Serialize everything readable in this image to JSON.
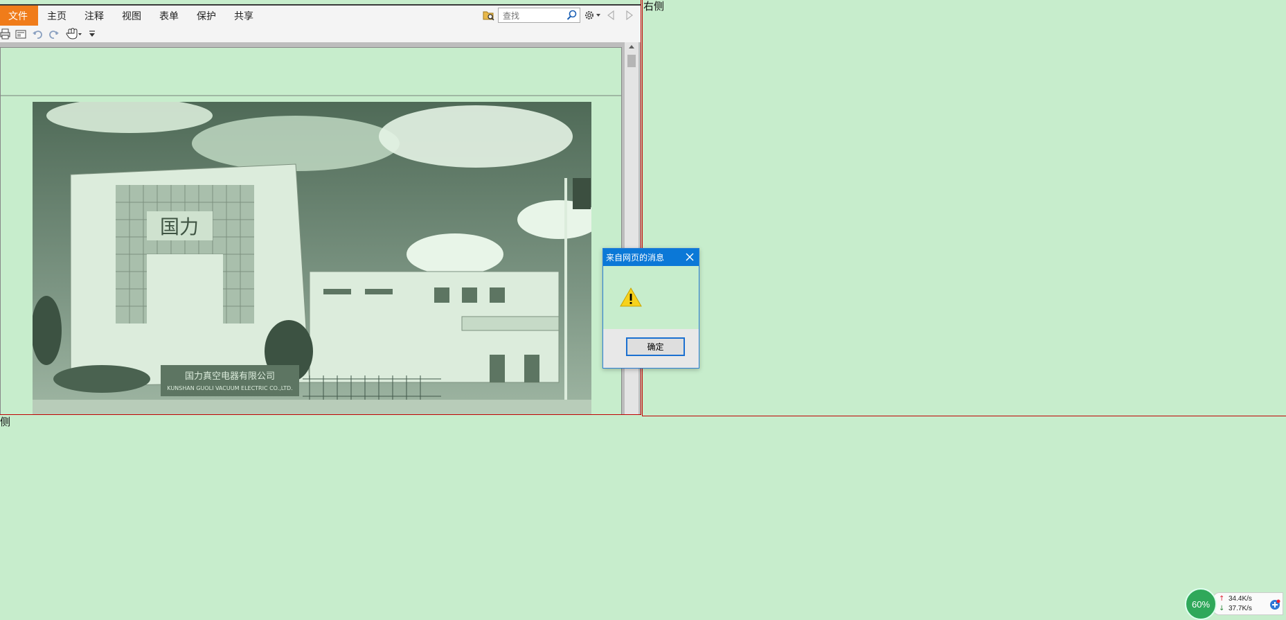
{
  "ribbon": {
    "tabs": [
      "文件",
      "主页",
      "注释",
      "视图",
      "表单",
      "保护",
      "共享"
    ],
    "search_placeholder": "查找"
  },
  "icons": {
    "folder_search": "folder-search-icon",
    "search": "search-icon",
    "settings": "gear-icon",
    "prev": "triangle-left-icon",
    "next": "triangle-right-icon",
    "print": "print-icon",
    "page_view": "page-icon",
    "undo": "undo-icon",
    "redo": "redo-icon",
    "hand": "hand-tool-icon",
    "customize": "dropdown-arrow-icon",
    "warning": "warning-icon",
    "close": "close-icon"
  },
  "frames": {
    "right_label": "右侧",
    "left_bottom_label": "侧"
  },
  "dialog": {
    "title": "来自网页的消息",
    "ok_label": "确定"
  },
  "network": {
    "percent": "60%",
    "upload": "34.4K/s",
    "download": "37.7K/s"
  },
  "colors": {
    "background": "#c7edcc",
    "file_tab": "#f07c1a",
    "dialog_titlebar": "#0b78d7",
    "frame_border": "#c00000"
  }
}
